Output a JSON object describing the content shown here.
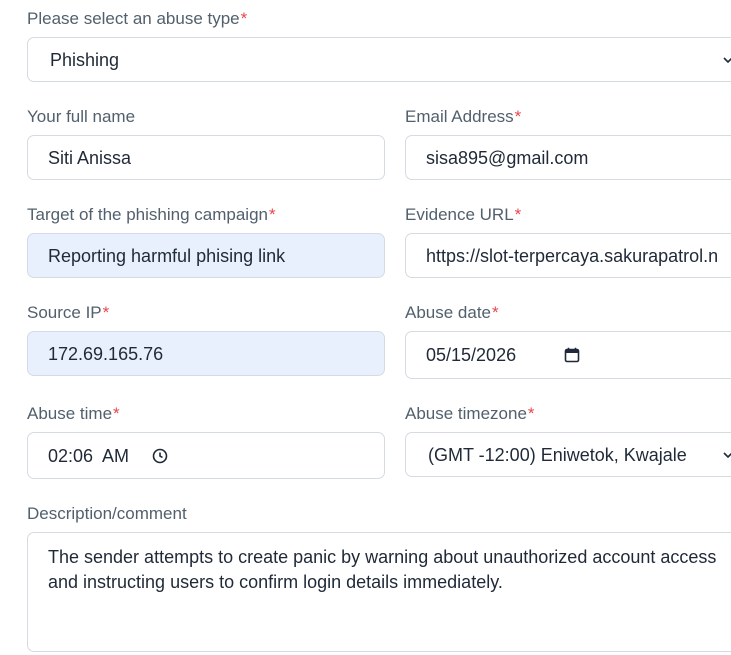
{
  "abuse_type": {
    "label": "Please select an abuse type",
    "value": "Phishing",
    "icon": "chevron-down-icon"
  },
  "full_name": {
    "label": "Your full name",
    "value": "Siti Anissa"
  },
  "email": {
    "label": "Email Address",
    "value": "sisa895@gmail.com"
  },
  "target": {
    "label": "Target of the phishing campaign",
    "value": "Reporting harmful phising link"
  },
  "evidence_url": {
    "label": "Evidence URL",
    "value": "https://slot-terpercaya.sakurapatrol.n"
  },
  "source_ip": {
    "label": "Source IP",
    "value": "172.69.165.76"
  },
  "abuse_date": {
    "label": "Abuse date",
    "value": "05/15/2026",
    "icon": "calendar-icon"
  },
  "abuse_time": {
    "label": "Abuse time",
    "value": "02:06  AM",
    "icon": "clock-icon"
  },
  "abuse_timezone": {
    "label": "Abuse timezone",
    "value": "(GMT -12:00) Eniwetok, Kwajale",
    "icon": "chevron-down-icon"
  },
  "description": {
    "label": "Description/comment",
    "value": "The sender attempts to create panic by warning about unauthorized account access and instructing users to confirm login details immediately."
  },
  "required_marker": "*",
  "colors": {
    "required": "#e5484d",
    "autofill_bg": "#e8f0fe",
    "label": "#52606d",
    "border": "#d6dbe1"
  }
}
